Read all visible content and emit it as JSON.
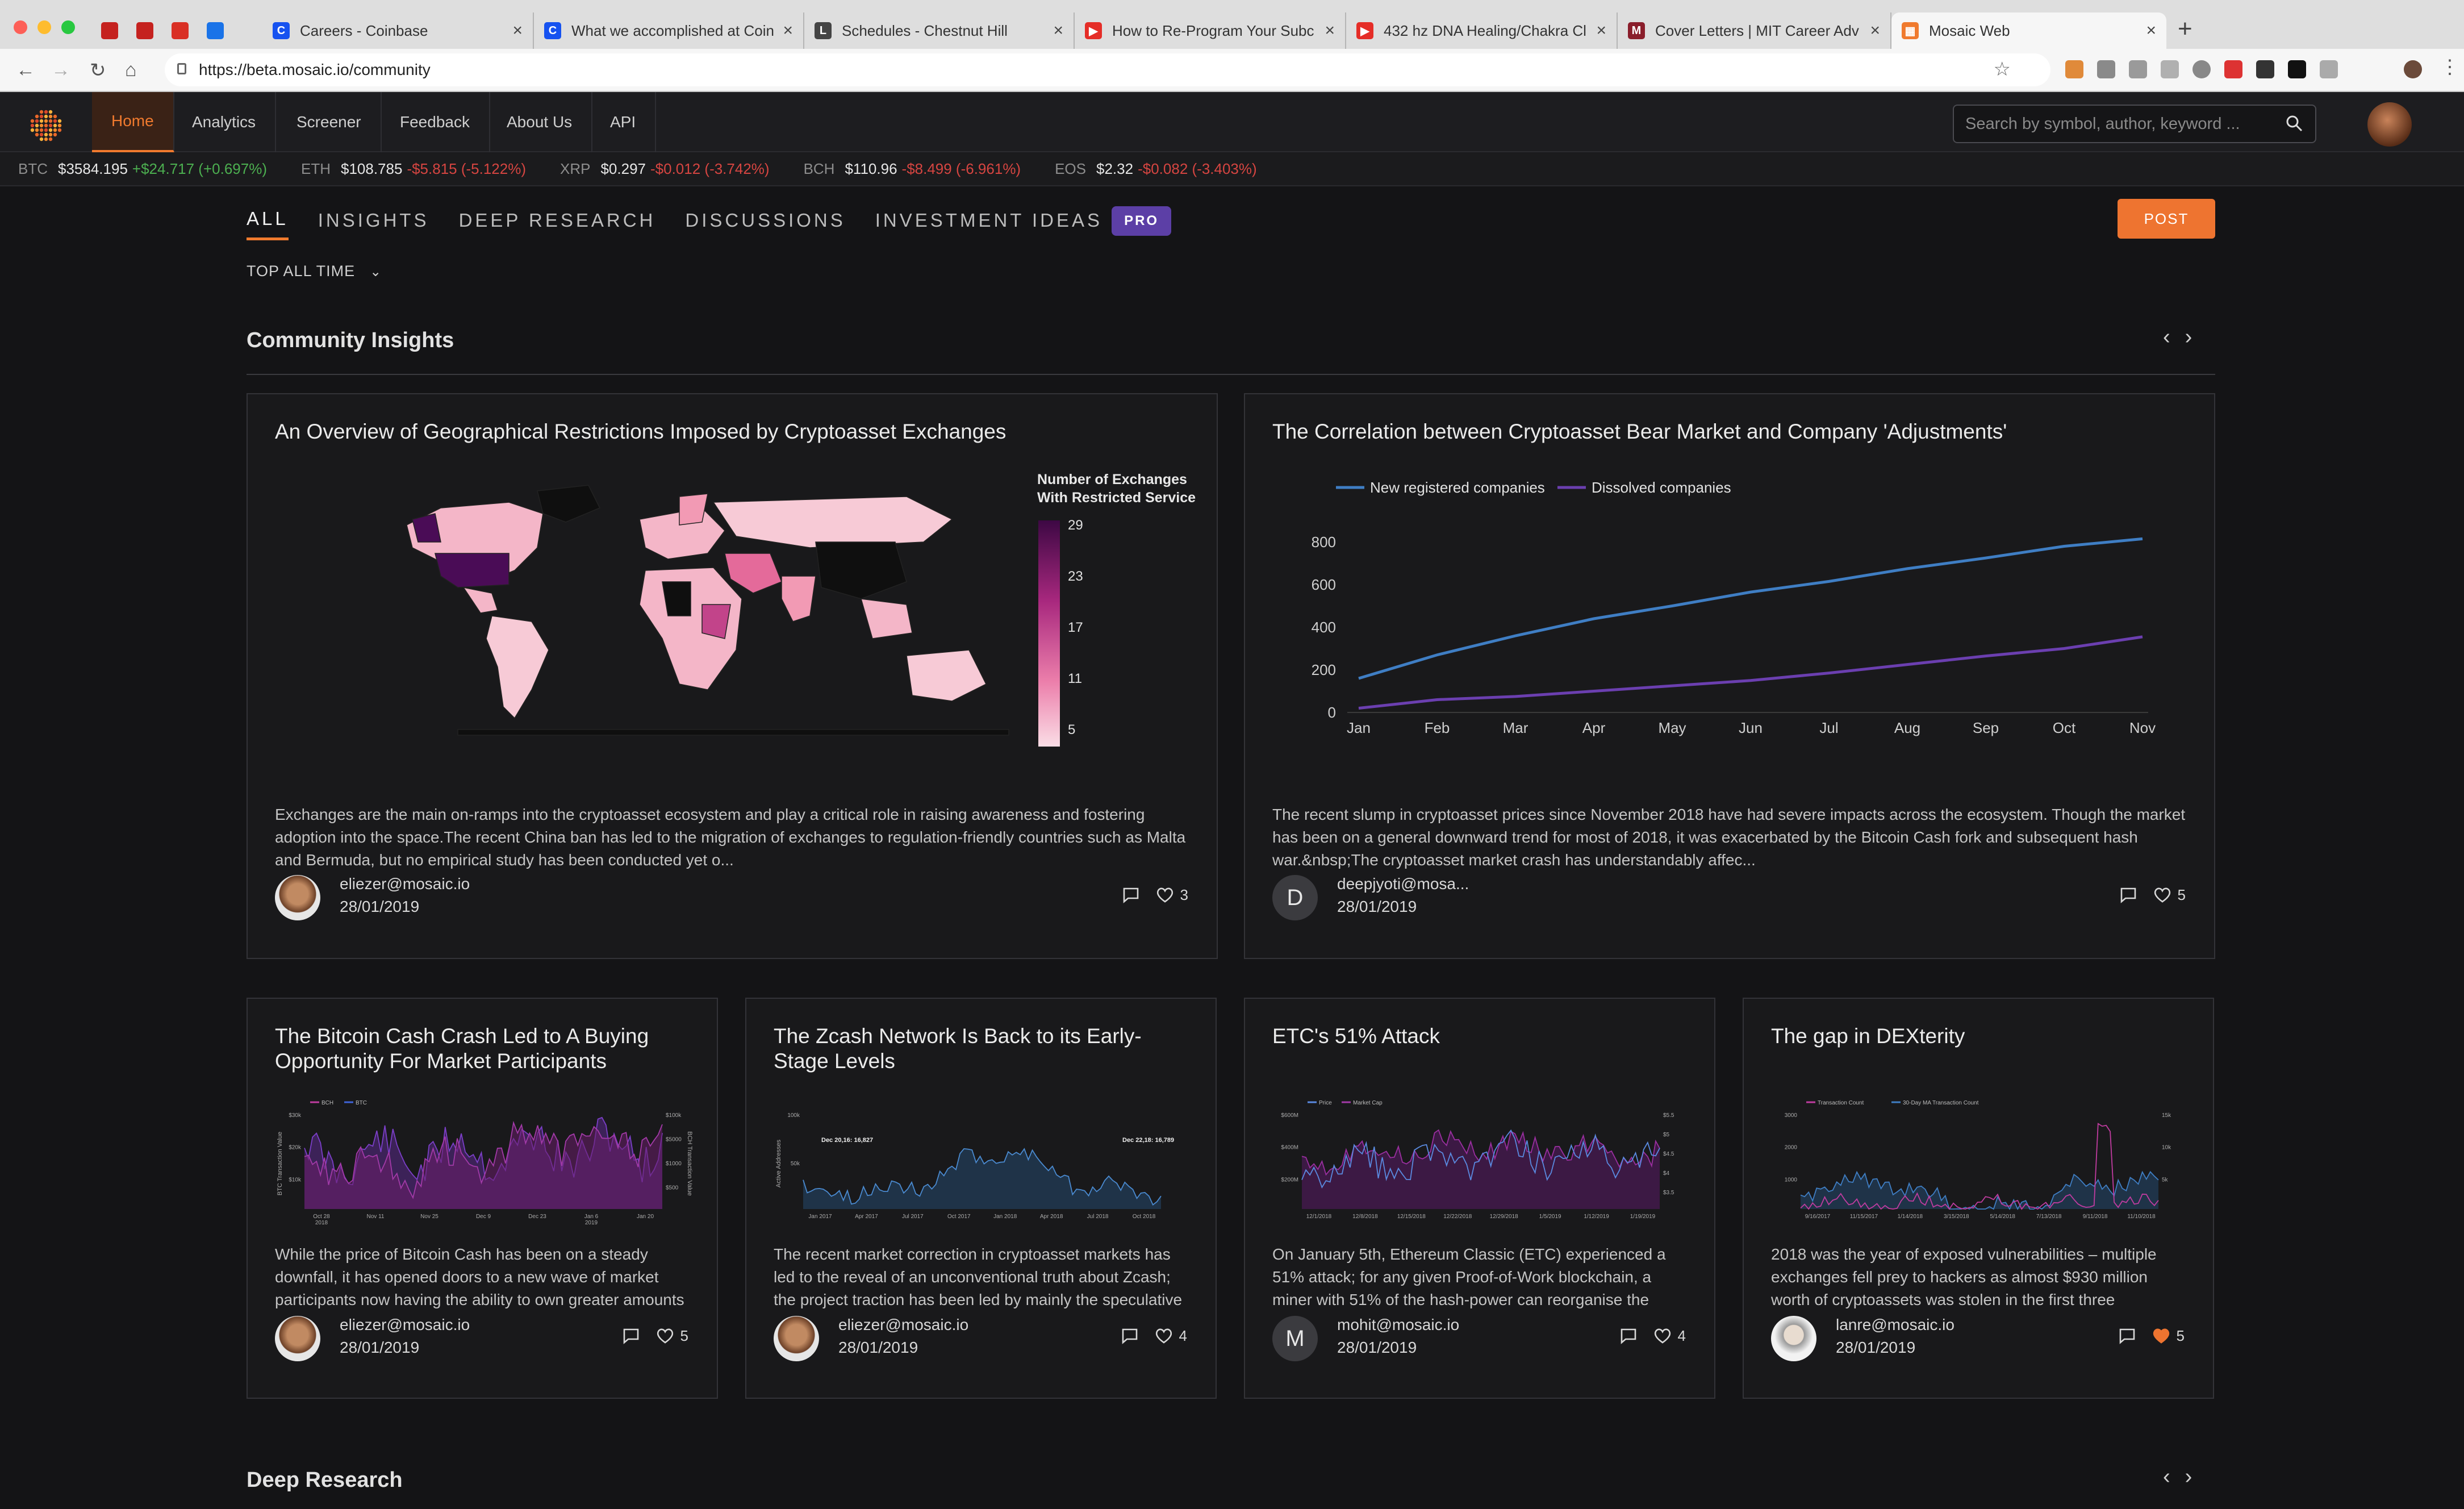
{
  "browser": {
    "tabs": [
      {
        "label": "",
        "fav": "gmail-icon",
        "color": "#c5221f"
      },
      {
        "label": "",
        "fav": "gmail-icon",
        "color": "#c5221f"
      },
      {
        "label": "",
        "fav": "app-icon",
        "color": "#d93025"
      },
      {
        "label": "",
        "fav": "calendar-icon",
        "color": "#1a73e8"
      },
      {
        "label": "Careers - Coinbase",
        "fav": "C",
        "color": "#1652f0"
      },
      {
        "label": "What we accomplished at Coin",
        "fav": "C",
        "color": "#1652f0"
      },
      {
        "label": "Schedules - Chestnut Hill",
        "fav": "L",
        "color": "#444"
      },
      {
        "label": "How to Re-Program Your Subc",
        "fav": "▶",
        "color": "#e52d27"
      },
      {
        "label": "432 hz DNA Healing/Chakra Cl",
        "fav": "▶",
        "color": "#e52d27"
      },
      {
        "label": "Cover Letters | MIT Career Adv",
        "fav": "M",
        "color": "#8a1e2b"
      },
      {
        "label": "Mosaic Web",
        "fav": "▦",
        "color": "#f07a2e"
      }
    ],
    "url": "https://beta.mosaic.io/community"
  },
  "nav": {
    "items": [
      "Home",
      "Analytics",
      "Screener",
      "Feedback",
      "About Us",
      "API"
    ],
    "search_placeholder": "Search by symbol, author, keyword ..."
  },
  "ticker": [
    {
      "sym": "BTC",
      "price": "$3584.195",
      "change": "+$24.717 (+0.697%)",
      "dir": "up"
    },
    {
      "sym": "ETH",
      "price": "$108.785",
      "change": "-$5.815 (-5.122%)",
      "dir": "dn"
    },
    {
      "sym": "XRP",
      "price": "$0.297",
      "change": "-$0.012 (-3.742%)",
      "dir": "dn"
    },
    {
      "sym": "BCH",
      "price": "$110.96",
      "change": "-$8.499 (-6.961%)",
      "dir": "dn"
    },
    {
      "sym": "EOS",
      "price": "$2.32",
      "change": "-$0.082 (-3.403%)",
      "dir": "dn"
    }
  ],
  "filters": {
    "tabs": [
      "ALL",
      "INSIGHTS",
      "DEEP RESEARCH",
      "DISCUSSIONS",
      "INVESTMENT IDEAS"
    ],
    "pro_badge": "PRO",
    "post": "POST",
    "sort": "TOP ALL TIME"
  },
  "sections": {
    "insights_title": "Community Insights",
    "research_title": "Deep Research"
  },
  "cards": [
    {
      "title": "An Overview of Geographical Restrictions Imposed by Cryptoasset Exchanges",
      "desc": "Exchanges are the main on-ramps into the cryptoasset ecosystem and play a critical role in raising awareness and fostering adoption into the space.The recent China ban has led to the migration of exchanges to regulation-friendly countries such as Malta and Bermuda, but no empirical study has been conducted yet o...",
      "author": "eliezer@mosaic.io",
      "date": "28/01/2019",
      "likes": "3",
      "liked": false
    },
    {
      "title": "The Correlation between Cryptoasset Bear Market and Company 'Adjustments'",
      "desc": "The recent slump in cryptoasset prices since November 2018 have had severe impacts across the ecosystem. Though the market has been on a general downward trend for most of 2018, it was exacerbated by the Bitcoin Cash fork and subsequent hash war.&nbsp;The cryptoasset market crash has understandably affec...",
      "author": "deepjyoti@mosa...",
      "date": "28/01/2019",
      "likes": "5",
      "avatar_letter": "D",
      "liked": false
    },
    {
      "title": "The Bitcoin Cash Crash Led to A Buying Opportunity For Market Participants",
      "desc": "While the price of Bitcoin Cash has been on a steady downfall, it has opened doors to a new wave of market participants now having the ability to own greater amounts",
      "author": "eliezer@mosaic.io",
      "date": "28/01/2019",
      "likes": "5",
      "liked": false
    },
    {
      "title": "The Zcash Network Is Back to its Early-Stage Levels",
      "desc": "The recent market correction in cryptoasset markets has led to the reveal of an unconventional truth about Zcash; the project traction has been led by mainly the speculative",
      "author": "eliezer@mosaic.io",
      "date": "28/01/2019",
      "likes": "4",
      "liked": false
    },
    {
      "title": "ETC's 51% Attack",
      "desc": "On January 5th, Ethereum Classic (ETC) experienced a 51% attack; for any given Proof-of-Work blockchain, a miner with 51% of the hash-power can reorganise the",
      "author": "mohit@mosaic.io",
      "date": "28/01/2019",
      "likes": "4",
      "avatar_letter": "M",
      "liked": false
    },
    {
      "title": "The gap in DEXterity",
      "desc": "2018 was the year of exposed vulnerabilities – multiple exchanges fell prey to hackers as almost $930 million worth of cryptoassets was stolen in the first three",
      "author": "lanre@mosaic.io",
      "date": "28/01/2019",
      "likes": "5",
      "liked": true
    }
  ],
  "map_legend": {
    "title_line1": "Number of Exchanges",
    "title_line2": "With Restricted Services",
    "ticks": [
      "29",
      "23",
      "17",
      "11",
      "5"
    ]
  },
  "chart_data": [
    {
      "type": "line",
      "categories": [
        "Jan",
        "Feb",
        "Mar",
        "Apr",
        "May",
        "Jun",
        "Jul",
        "Aug",
        "Sep",
        "Oct",
        "Nov"
      ],
      "series": [
        {
          "name": "New registered companies",
          "values": [
            160,
            270,
            360,
            440,
            500,
            565,
            615,
            675,
            725,
            780,
            815
          ],
          "color": "#3f7ec4"
        },
        {
          "name": "Dissolved companies",
          "values": [
            20,
            60,
            75,
            100,
            125,
            150,
            185,
            225,
            265,
            300,
            355
          ],
          "color": "#6b3fb0"
        }
      ],
      "yticks": [
        0,
        200,
        400,
        600,
        800
      ],
      "ylim": [
        0,
        880
      ],
      "legend": "top-left",
      "grid": false
    }
  ],
  "mini_charts": {
    "bch": {
      "legend": [
        "BCH",
        "BTC"
      ],
      "yleft": "BTC Transaction Value",
      "yright": "BCH Transaction Value",
      "lticks": [
        "$30k",
        "$20k",
        "$10k"
      ],
      "rticks": [
        "$100k",
        "$5000",
        "$1000",
        "$500"
      ],
      "xticks": [
        "Oct 28\n2018",
        "Nov 11",
        "Nov 25",
        "Dec 9",
        "Dec 23",
        "Jan 6\n2019",
        "Jan 20"
      ]
    },
    "zec": {
      "yleft": "Active Addresses",
      "lticks": [
        "100k",
        "50k"
      ],
      "ann1": "Dec 20,16: 16,827",
      "ann2": "Dec 22,18: 16,789",
      "xticks": [
        "Jan 2017",
        "Apr 2017",
        "Jul 2017",
        "Oct 2017",
        "Jan 2018",
        "Apr 2018",
        "Jul 2018",
        "Oct 2018"
      ]
    },
    "etc": {
      "legend": [
        "Price",
        "Market Cap"
      ],
      "lticks": [
        "$600M",
        "$400M",
        "$200M"
      ],
      "rticks": [
        "$5.5",
        "$5",
        "$4.5",
        "$4",
        "$3.5"
      ],
      "xticks": [
        "12/1/2018",
        "12/8/2018",
        "12/15/2018",
        "12/22/2018",
        "12/29/2018",
        "1/5/2019",
        "1/12/2019",
        "1/19/2019"
      ]
    },
    "dex": {
      "legend": [
        "Transaction Count",
        "30-Day MA Transaction Count"
      ],
      "lticks": [
        "3000",
        "2000",
        "1000"
      ],
      "rticks": [
        "15k",
        "10k",
        "5k"
      ],
      "xticks": [
        "9/16/2017",
        "11/15/2017",
        "1/14/2018",
        "3/15/2018",
        "5/14/2018",
        "7/13/2018",
        "9/11/2018",
        "11/10/2018"
      ]
    }
  }
}
